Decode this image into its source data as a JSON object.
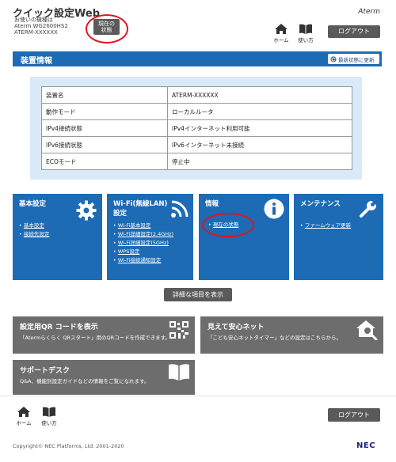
{
  "header": {
    "title": "クイック設定Web",
    "sublines": [
      "お使いの機種は",
      "Aterm WG2600HS2",
      "ATERM-XXXXXX"
    ],
    "status_button": [
      "現在の",
      "状態"
    ],
    "brand": "Aterm",
    "home_label": "ホーム",
    "help_label": "使い方",
    "logout_label": "ログアウト"
  },
  "section": {
    "title": "装置情報",
    "refresh_label": "最新状態に更新"
  },
  "info_table": [
    {
      "key": "装置名",
      "value": "ATERM-XXXXXX"
    },
    {
      "key": "動作モード",
      "value": "ローカルルータ"
    },
    {
      "key": "IPv4接続状態",
      "value": "IPv4インターネット利用可能"
    },
    {
      "key": "IPv6接続状態",
      "value": "IPv6インターネット未接続"
    },
    {
      "key": "ECOモード",
      "value": "停止中"
    }
  ],
  "tiles": [
    {
      "title": [
        "基本設定"
      ],
      "icon": "gear-icon",
      "links": [
        "基本設定",
        "接続先設定"
      ]
    },
    {
      "title": [
        "Wi-Fi(無線LAN)",
        "設定"
      ],
      "icon": "wifi-icon",
      "links": [
        "Wi-Fi基本設定",
        "Wi-Fi詳細設定(2.4GHz)",
        "Wi-Fi詳細設定(5GHz)",
        "WPS設定",
        "Wi-Fi接続通知設定"
      ]
    },
    {
      "title": [
        "情報"
      ],
      "icon": "info-icon",
      "links": [
        "現在の状態"
      ]
    },
    {
      "title": [
        "メンテナンス"
      ],
      "icon": "wrench-icon",
      "links": [
        "ファームウェア更新"
      ]
    }
  ],
  "detail_button": "詳細な項目を表示",
  "boxes": [
    {
      "title": "設定用QR コードを表示",
      "desc": "「Atermらくらく QRスタート」用のQRコードを作成できます。",
      "icon": "qr-code-icon"
    },
    {
      "title": "見えて安心ネット",
      "desc": "「こども安心ネットタイマー」などの設定はこちらから。",
      "icon": "house-search-icon"
    },
    {
      "title": "サポートデスク",
      "desc": "Q&A、機能別設定ガイドなどの情報をご覧になれます。",
      "icon": "book-icon"
    }
  ],
  "footer": {
    "home_label": "ホーム",
    "help_label": "使い方",
    "logout_label": "ログアウト",
    "copyright": "Copyright© NEC Platforms, Ltd. 2001-2020",
    "nec": "NEC"
  }
}
